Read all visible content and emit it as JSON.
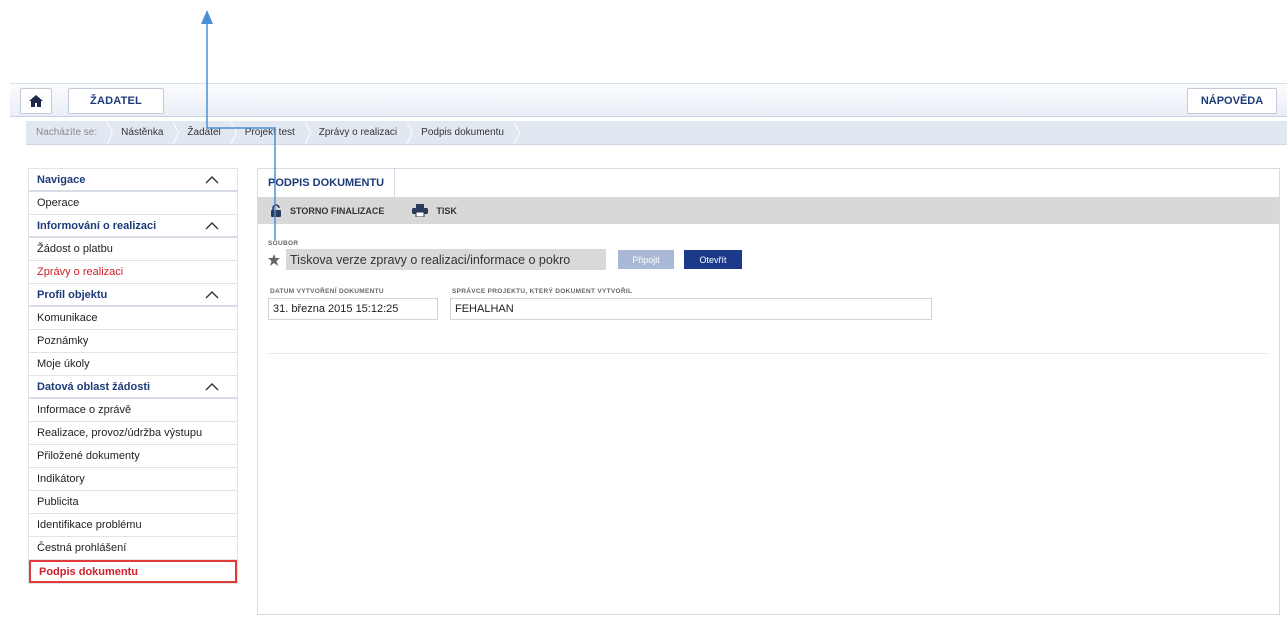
{
  "topbar": {
    "home_icon": "home-icon",
    "zadatel_label": "ŽADATEL",
    "napoveda_label": "NÁPOVĚDA"
  },
  "breadcrumb": {
    "prefix": "Nacházíte se:",
    "items": [
      "Nástěnka",
      "Žadatel",
      "Projekt test",
      "Zprávy o realizaci",
      "Podpis dokumentu"
    ]
  },
  "sidebar": {
    "sections": [
      {
        "title": "Navigace",
        "items": [
          "Operace"
        ]
      },
      {
        "title": "Informování o realizaci",
        "items": [
          "Žádost o platbu",
          "Zprávy o realizaci"
        ]
      },
      {
        "title": "Profil objektu",
        "items": [
          "Komunikace",
          "Poznámky",
          "Moje úkoly"
        ]
      },
      {
        "title": "Datová oblast žádosti",
        "items": [
          "Informace o zprávě",
          "Realizace, provoz/údržba výstupu",
          "Přiložené dokumenty",
          "Indikátory",
          "Publicita",
          "Identifikace problému",
          "Čestná prohlášení",
          "Podpis dokumentu"
        ]
      }
    ]
  },
  "main": {
    "tab_label": "PODPIS DOKUMENTU",
    "toolbar": {
      "storno_label": "STORNO FINALIZACE",
      "tisk_label": "TISK"
    },
    "file": {
      "label": "SOUBOR",
      "value": "Tiskova verze zpravy o realizaci/informace o pokro",
      "pripojit_label": "Připojit",
      "otevrit_label": "Otevřít"
    },
    "date": {
      "label": "DATUM VYTVOŘENÍ DOKUMENTU",
      "value": "31. března 2015 15:12:25"
    },
    "manager": {
      "label": "SPRÁVCE PROJEKTU, KTERÝ DOKUMENT VYTVOŘIL",
      "value": "FEHALHAN"
    }
  },
  "colors": {
    "brand_blue": "#1d3a78",
    "active_red": "#d0202a",
    "arrow_blue": "#4a8fd8"
  }
}
